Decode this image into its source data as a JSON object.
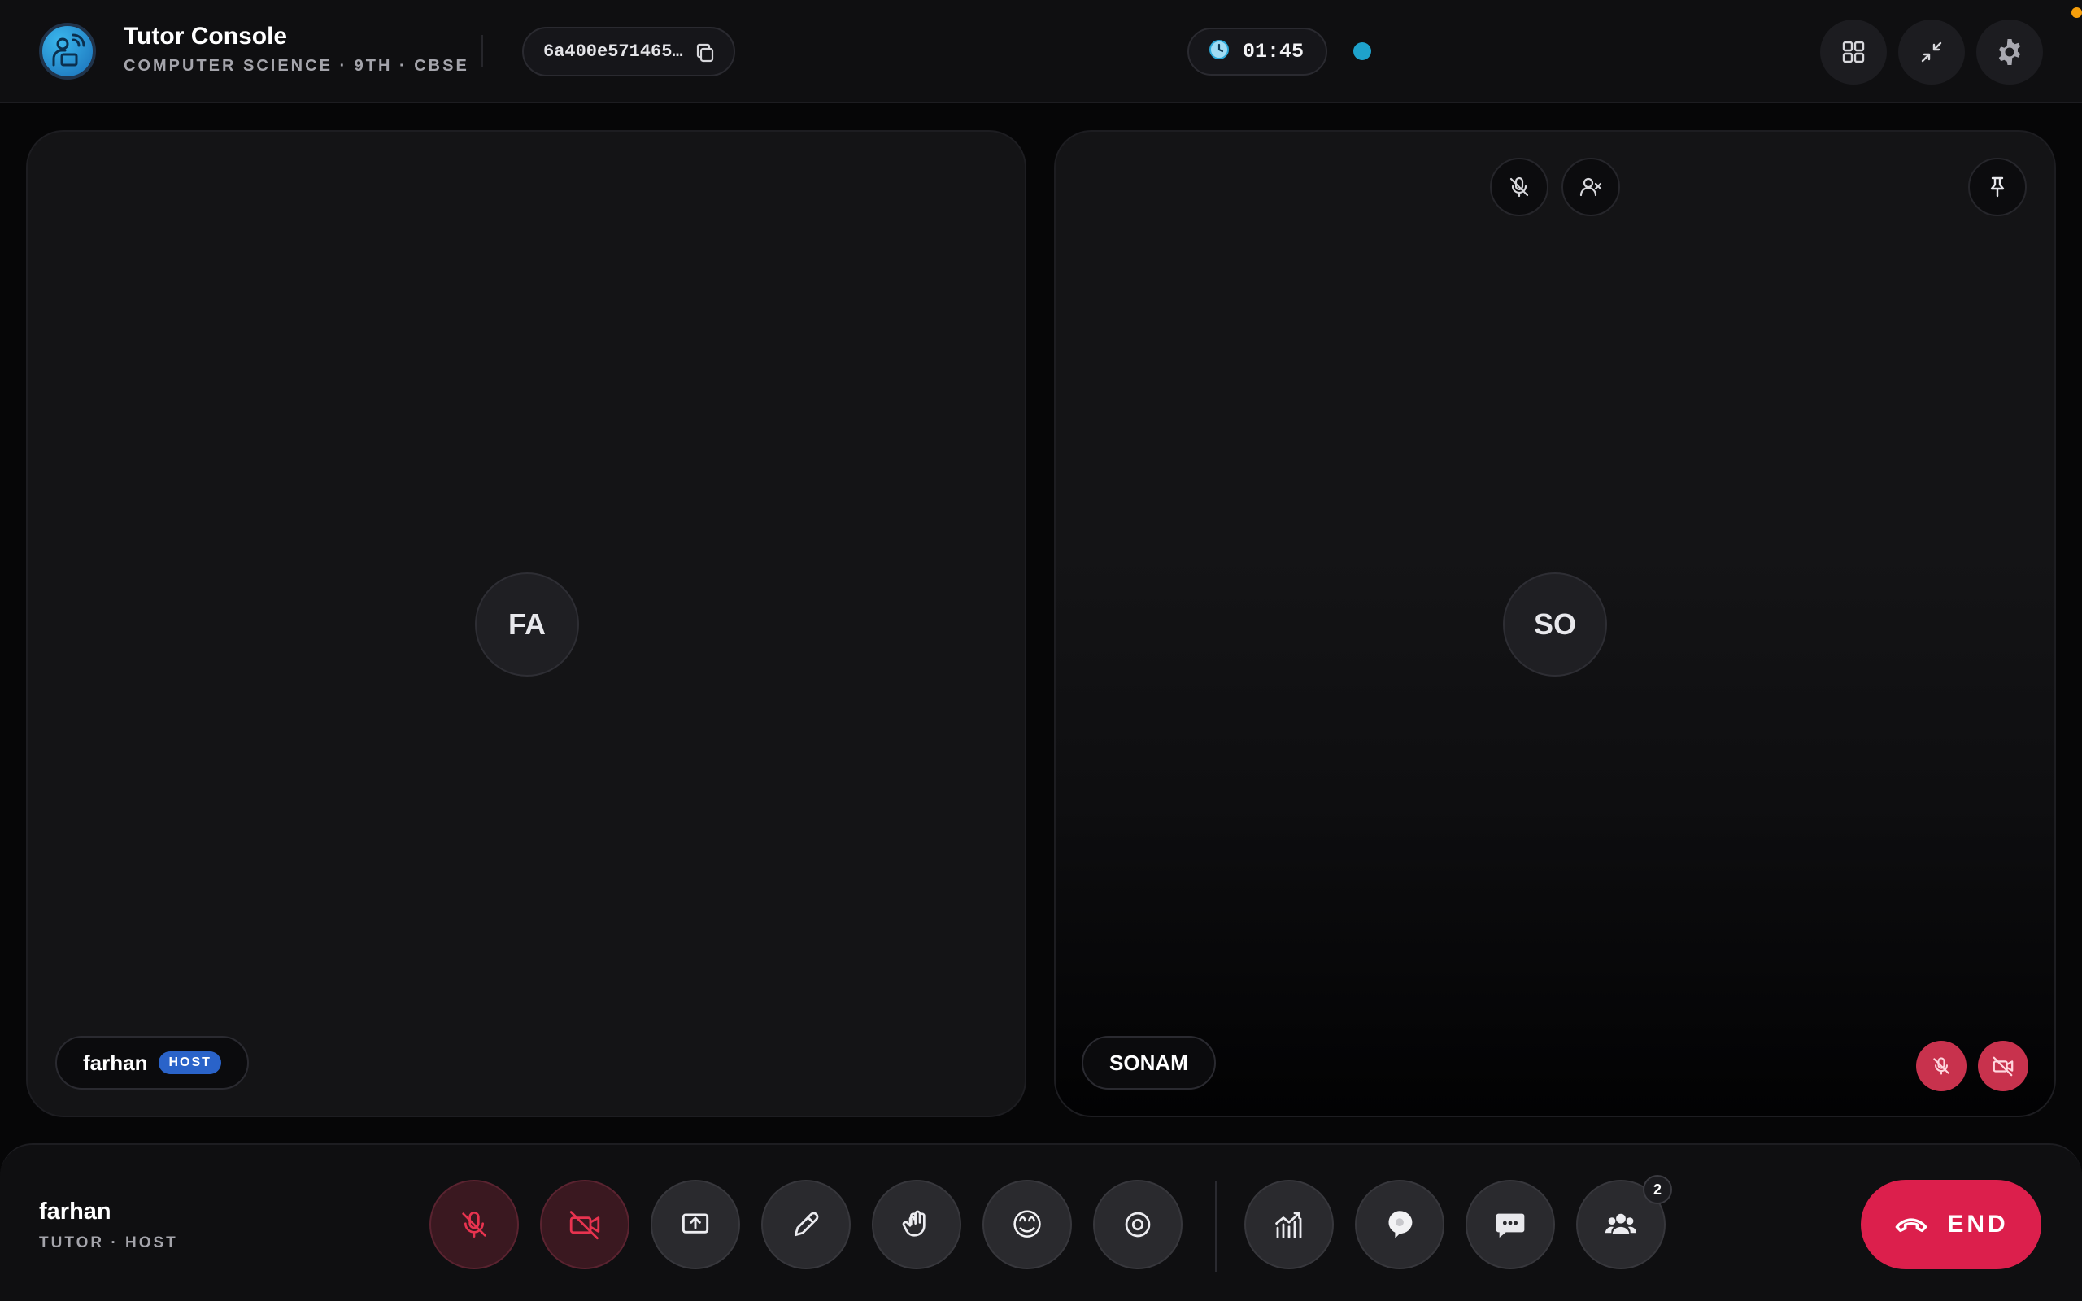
{
  "header": {
    "title": "Tutor Console",
    "subtitle": "COMPUTER SCIENCE · 9TH · CBSE",
    "room_id": "6a400e571465…",
    "timer": "01:45",
    "icons": {
      "logo": "tutor-logo-icon",
      "copy": "copy-icon",
      "clock": "clock-icon",
      "grid": "grid-layout-icon",
      "minimize": "minimize-icon",
      "settings": "gear-icon"
    },
    "colors": {
      "live": "#1ea2cc",
      "corner": "#f59e0b"
    }
  },
  "tiles": [
    {
      "initials": "FA",
      "name": "farhan",
      "badge": "HOST"
    },
    {
      "initials": "SO",
      "name": "SONAM"
    }
  ],
  "tile_controls": [
    "mute-participant",
    "remove-participant",
    "pin-tile"
  ],
  "self": {
    "name": "farhan",
    "role": "TUTOR · HOST"
  },
  "toolbar": {
    "buttons": [
      "mic-off",
      "camera-off",
      "share-screen",
      "annotate",
      "raise-hand",
      "reactions",
      "record",
      "analytics",
      "ai-assistant",
      "chat",
      "participants"
    ],
    "reaction_emoji": "😊",
    "participants_count": "2",
    "end_label": "END"
  },
  "colors": {
    "danger": "#dc1f4c",
    "host_badge": "#2a63c9",
    "muted": "#c8324d"
  }
}
